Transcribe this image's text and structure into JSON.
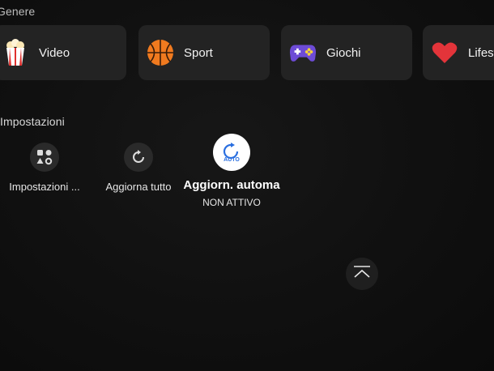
{
  "genre": {
    "title": "Genere",
    "items": [
      {
        "label": "Video",
        "icon": "popcorn-icon"
      },
      {
        "label": "Sport",
        "icon": "basketball-icon"
      },
      {
        "label": "Giochi",
        "icon": "gamepad-icon"
      },
      {
        "label": "Lifest",
        "icon": "heart-icon"
      }
    ]
  },
  "settings": {
    "title": "Impostazioni",
    "items": [
      {
        "label": "Impostazioni ...",
        "icon": "apps-settings-icon"
      },
      {
        "label": "Aggiorna tutto",
        "icon": "refresh-icon"
      },
      {
        "label": "Aggiorn. automa",
        "status": "NON ATTIVO",
        "badge": "AUTO",
        "icon": "auto-update-icon"
      }
    ]
  },
  "scroll_top": {
    "icon": "scroll-to-top-icon"
  },
  "colors": {
    "accent": "#2a6fe0",
    "card_bg": "#232323"
  }
}
